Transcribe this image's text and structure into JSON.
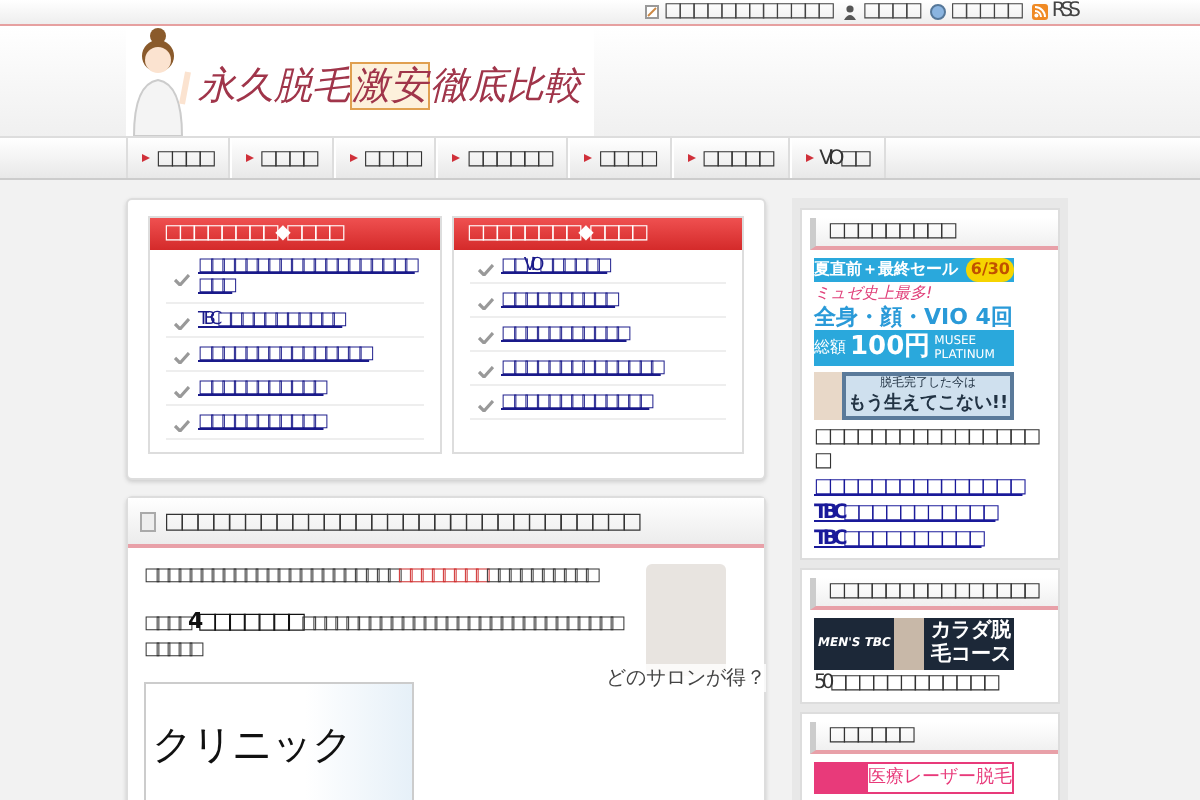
{
  "top_links": [
    {
      "text": "□□□□□□□□□□□□",
      "kind": "memo"
    },
    {
      "text": "□□□□",
      "kind": "person"
    },
    {
      "text": "□□□□□",
      "kind": "globe"
    },
    {
      "text": "RSS",
      "kind": "rss"
    }
  ],
  "logo": {
    "title_start": "永久脱毛",
    "title_highlight": "激安",
    "title_end": "徹底比較"
  },
  "nav": [
    {
      "label": "□□□□"
    },
    {
      "label": "□□□□"
    },
    {
      "label": "□□□□"
    },
    {
      "label": "□□□□□□"
    },
    {
      "label": "□□□□"
    },
    {
      "label": "□□□□□"
    },
    {
      "label": "VIO□□"
    }
  ],
  "ranking_boxes": [
    {
      "title": "□□□□□□□□◆□□□□",
      "items": [
        "□□□□□□□□□□□□□□□□□□□□□□",
        "TBC□□□□□□□□□□□",
        "□□□□□□□□□□□□□□□",
        "□□□□□□□□□□□",
        "□□□□□□□□□□□"
      ]
    },
    {
      "title": "□□□□□□□□◆□□□□",
      "items": [
        "□□VIO□□□□□□",
        "□□□□□□□□□□",
        "□□□□□□□□□□□",
        "□□□□□□□□□□□□□□",
        "□□□□□□□□□□□□□"
      ]
    }
  ],
  "article": {
    "title": "□□□□□□□□□□□□□□□□□□□□□□□□□□□□□□",
    "paragraphs": [
      [
        {
          "text": "□□□□□□□□□□□□□□□□□□□□□□□",
          "kind": "plain"
        },
        {
          "text": "□□□□□□□□",
          "kind": "red"
        },
        {
          "text": "□□□□□□□□□□",
          "kind": "plain"
        }
      ],
      [
        {
          "text": "□□□□",
          "kind": "plain"
        },
        {
          "text": "4□□□□□□□",
          "kind": "bold"
        },
        {
          "text": "□□□□□□□□□□□□□□□□□□□□□□□□□□□□□□□□□□",
          "kind": "plain"
        }
      ]
    ],
    "photo_caption": "どのサロンが得？",
    "image_text": "クリニック"
  },
  "sidebar": [
    {
      "title": "□□□□□□□□□",
      "banners": [
        {
          "kind": "musee",
          "lines": [
            "夏直前＋最終セール",
            "6/30",
            "ミュゼ史上最多!",
            "全身・顔・VIO 4回",
            "総額",
            "100円",
            "MUSEE PLATINUM"
          ]
        },
        {
          "kind": "hair",
          "lines": [
            "脱毛完了した今は",
            "もう生えてこない!!"
          ]
        }
      ],
      "links": [
        {
          "text": "□□□□□□□□□□□□□□□□□",
          "kind": "text"
        },
        {
          "text": "□□□□□□□□□□□□□□□",
          "kind": "link"
        },
        {
          "text": "TBC□□□□□□□□□□□",
          "kind": "link"
        },
        {
          "text": "TBC□□□□□□□□□□",
          "kind": "link"
        }
      ]
    },
    {
      "title": "□□□□□□□□□□□□□□□",
      "banners": [
        {
          "kind": "tbc",
          "lines": [
            "MEN'S TBC",
            "カラダ脱毛コース"
          ]
        }
      ],
      "links": [
        {
          "text": "50□□□□□□□□□□□□",
          "kind": "text"
        }
      ]
    },
    {
      "title": "□□□□□□",
      "banners": [
        {
          "kind": "laser",
          "lines": [
            "医療レーザー脱毛"
          ]
        }
      ]
    }
  ]
}
